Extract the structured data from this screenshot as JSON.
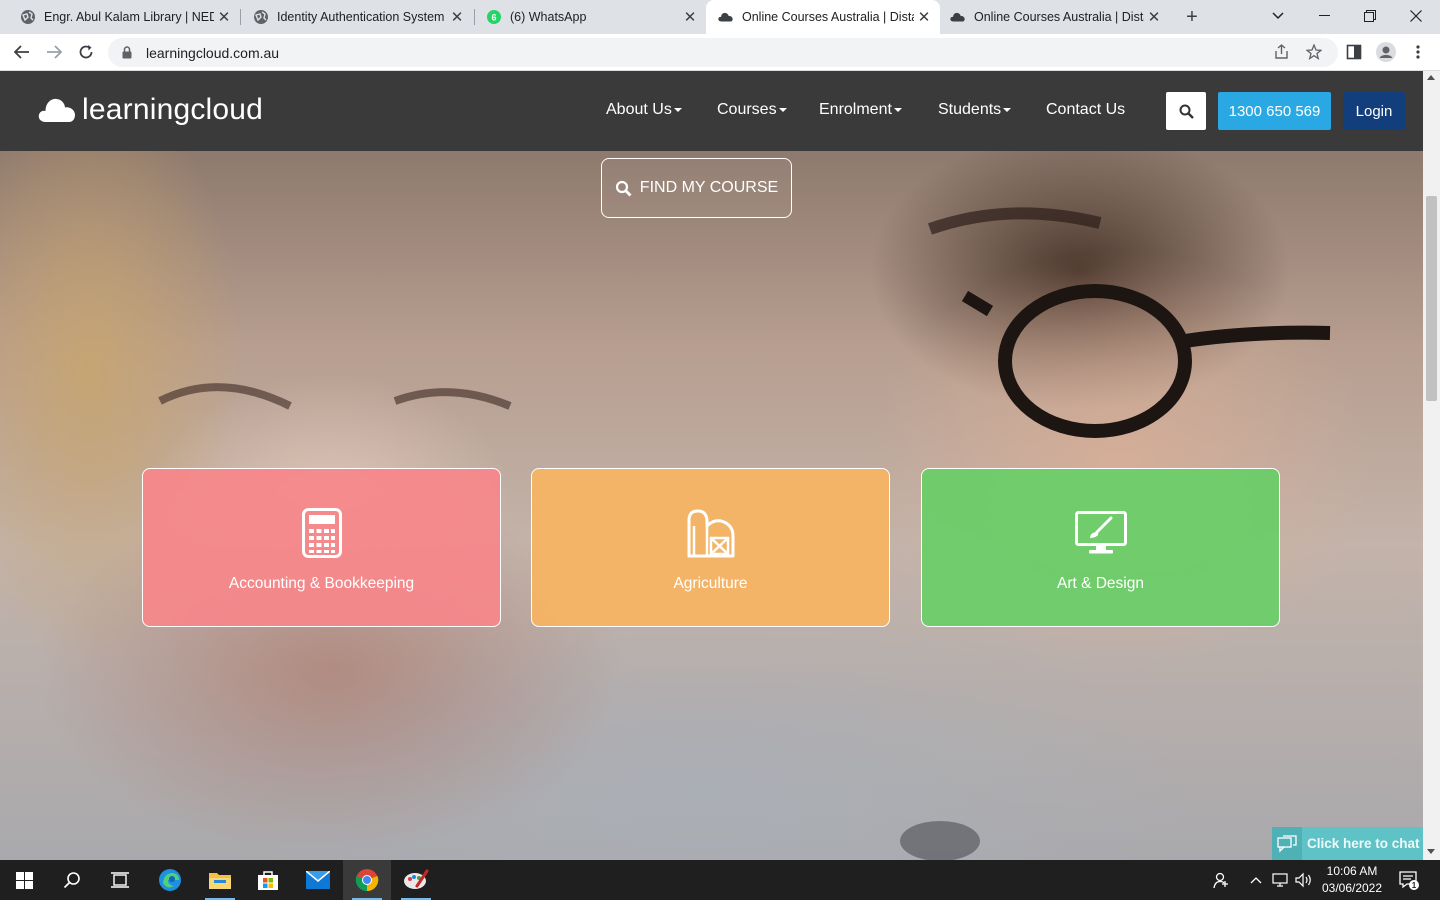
{
  "browser": {
    "tabs": [
      {
        "title": "Engr. Abul Kalam Library | NEDU",
        "icon": "globe-icon",
        "active": false
      },
      {
        "title": "Identity Authentication System",
        "icon": "globe-icon",
        "active": false
      },
      {
        "title": "(6) WhatsApp",
        "icon": "whatsapp-icon",
        "badge": "6",
        "active": false
      },
      {
        "title": "Online Courses Australia | Distance",
        "icon": "cloud-icon",
        "active": true
      },
      {
        "title": "Online Courses Australia | Distance",
        "icon": "cloud-icon",
        "active": false
      }
    ],
    "url": "learningcloud.com.au"
  },
  "site": {
    "logo_text": "learningcloud",
    "nav": [
      {
        "label": "About Us",
        "has_dropdown": true
      },
      {
        "label": "Courses",
        "has_dropdown": true
      },
      {
        "label": "Enrolment",
        "has_dropdown": true
      },
      {
        "label": "Students",
        "has_dropdown": true
      },
      {
        "label": "Contact Us",
        "has_dropdown": false
      }
    ],
    "phone": "1300 650 569",
    "login_label": "Login",
    "find_course_label": "FIND MY COURSE",
    "categories": [
      {
        "label": "Accounting & Bookkeeping",
        "icon": "calculator-icon",
        "color": "#f6878a"
      },
      {
        "label": "Agriculture",
        "icon": "barn-icon",
        "color": "#f7b462"
      },
      {
        "label": "Art & Design",
        "icon": "monitor-brush-icon",
        "color": "#6ccd68"
      }
    ],
    "chat_label": "Click here to chat"
  },
  "taskbar": {
    "time": "10:06 AM",
    "date": "03/06/2022",
    "notification_count": "1"
  },
  "colors": {
    "header_bg": "#3a3a3a",
    "phone_btn": "#29a8e3",
    "login_btn": "#133e7c",
    "chat_widget": "#5ec2c7"
  }
}
